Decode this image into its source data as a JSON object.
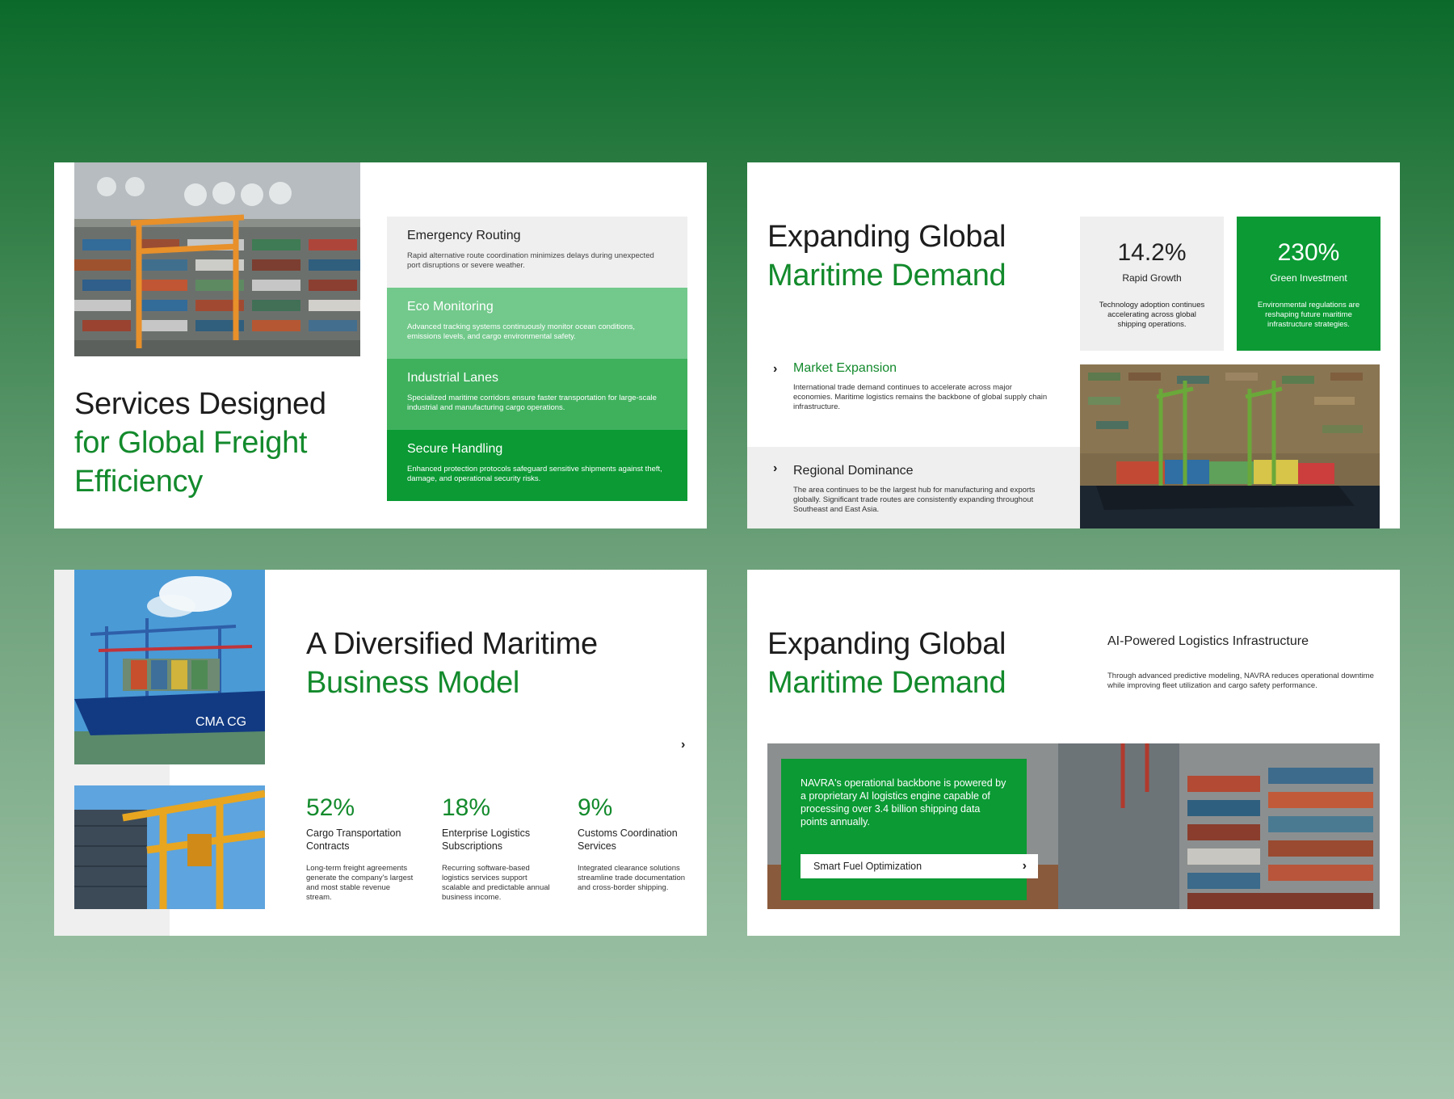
{
  "slide1": {
    "title": {
      "line1": "Services Designed",
      "line2": "for Global Freight",
      "line3": "Efficiency"
    },
    "services": [
      {
        "title": "Emergency Routing",
        "desc": "Rapid alternative route coordination minimizes delays during unexpected port disruptions or severe weather."
      },
      {
        "title": "Eco Monitoring",
        "desc": "Advanced tracking systems continuously monitor ocean conditions, emissions levels, and cargo environmental safety."
      },
      {
        "title": "Industrial Lanes",
        "desc": "Specialized maritime corridors ensure faster transportation for large-scale industrial and manufacturing cargo operations."
      },
      {
        "title": "Secure Handling",
        "desc": "Enhanced protection protocols safeguard sensitive shipments against theft, damage, and operational security risks."
      }
    ]
  },
  "slide2": {
    "title": {
      "line1": "Expanding Global",
      "line2": "Maritime Demand"
    },
    "stats": [
      {
        "value": "14.2%",
        "label": "Rapid Growth",
        "desc": "Technology adoption continues accelerating across global shipping operations."
      },
      {
        "value": "230%",
        "label": "Green Investment",
        "desc": "Environmental regulations are reshaping future maritime infrastructure strategies."
      }
    ],
    "features": [
      {
        "title": "Market Expansion",
        "desc": "International trade demand continues to accelerate across major economies. Maritime logistics remains the backbone of global supply chain infrastructure."
      },
      {
        "title": "Regional Dominance",
        "desc": "The area continues to be the largest hub for manufacturing and exports globally. Significant trade routes are consistently expanding throughout Southeast and East Asia."
      }
    ]
  },
  "slide3": {
    "title": {
      "line1": "A Diversified Maritime",
      "line2": "Business Model"
    },
    "stats": [
      {
        "value": "52%",
        "label": "Cargo Transportation Contracts",
        "desc": "Long-term freight agreements generate the company's largest and most stable revenue stream."
      },
      {
        "value": "18%",
        "label": "Enterprise Logistics Subscriptions",
        "desc": "Recurring software-based logistics services support scalable and predictable annual business income."
      },
      {
        "value": "9%",
        "label": "Customs Coordination Services",
        "desc": "Integrated clearance solutions streamline trade documentation and cross-border shipping."
      }
    ],
    "ship_text": "CMA CG"
  },
  "slide4": {
    "title": {
      "line1": "Expanding Global",
      "line2": "Maritime Demand"
    },
    "subheading": "AI-Powered Logistics Infrastructure",
    "subdesc": "Through advanced predictive modeling, NAVRA reduces operational downtime while improving fleet utilization and cargo safety performance.",
    "box_text": "NAVRA's operational backbone is powered by a proprietary AI logistics engine capable of processing over 3.4 billion shipping data points annually.",
    "button_label": "Smart Fuel Optimization"
  },
  "colors": {
    "brand_green": "#0b9a34",
    "title_green": "#138a2c",
    "light_grey": "#efefef"
  },
  "icons": {
    "chevron": "chevron-right-icon"
  }
}
